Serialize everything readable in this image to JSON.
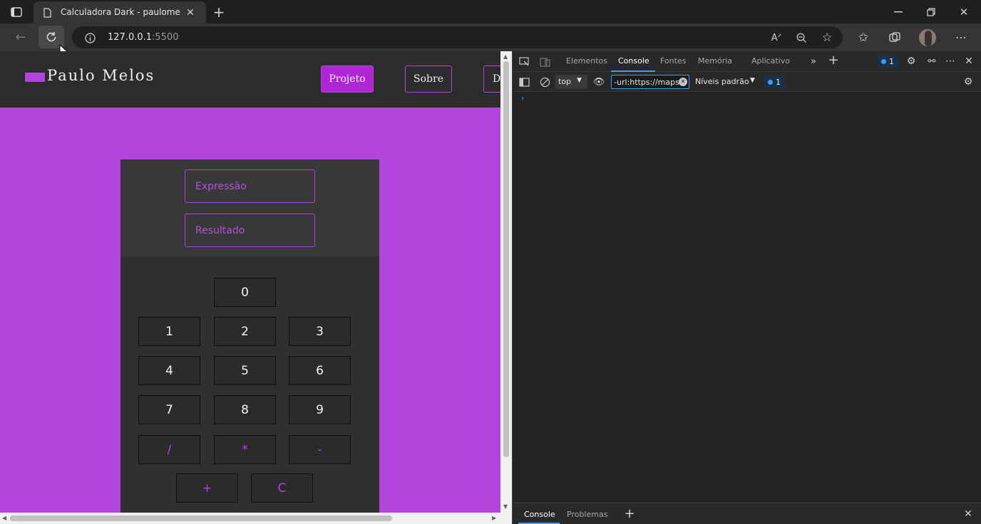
{
  "browser": {
    "tab_title": "Calculadora Dark - paulomelos",
    "url_host": "127.0.0.1",
    "url_port": ":5500"
  },
  "site": {
    "logo_text": "Paulo Melos",
    "nav": [
      {
        "label": "Projeto",
        "active": true
      },
      {
        "label": "Sobre",
        "active": false
      },
      {
        "label": "D",
        "active": false
      }
    ]
  },
  "calculator": {
    "expression_placeholder": "Expressão",
    "result_placeholder": "Resultado",
    "keys": {
      "k0": "0",
      "k1": "1",
      "k2": "2",
      "k3": "3",
      "k4": "4",
      "k5": "5",
      "k6": "6",
      "k7": "7",
      "k8": "8",
      "k9": "9",
      "divide": "/",
      "multiply": "*",
      "minus": "-",
      "plus": "+",
      "clear": "C"
    }
  },
  "devtools": {
    "tabs": [
      "Elementos",
      "Console",
      "Fontes",
      "Memória",
      "Aplicativo"
    ],
    "active_tab": "Console",
    "context": "top",
    "filter_value": "-url:https://maps.",
    "levels": "Níveis padrão",
    "issues_count": "1",
    "drawer_tabs": [
      "Console",
      "Problemas"
    ]
  },
  "colors": {
    "accent": "#b044dd",
    "page_bg": "#b044dd",
    "header_bg": "#2c2c2c",
    "calc_bg": "#303030"
  }
}
